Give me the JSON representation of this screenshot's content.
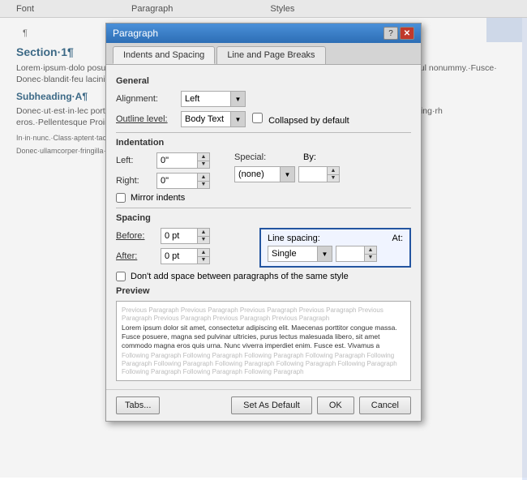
{
  "toolbar": {
    "items": [
      "Font",
      "Paragraph",
      "Styles"
    ]
  },
  "document": {
    "pilcrow": "¶",
    "section_title": "Section·1¶",
    "section_body": "Lorem·ipsum·dolo posuere,·magna·s quis·urna.·Nunc· tristique·senectu et·orci.·Aenean·n scelerisque·at,·vul nonummy.·Fusce· Donec·blandit·feu lacinia·nulla·nisl·e",
    "subheading": "Subheading·A¶",
    "sub_body": "Donec·ut·est·in·lec porta·tristique.·Pr senectus·et·netus· vulputate·vel,·auc lacinia·egestas·ac· ante·adipiscing·rh eros.·Pellentesque Proin·semper,·ant eget,·Sed·vel eget,·consequat·q",
    "footer_text": "In·in·nunc.·Class·aptent·taciti·sociosqu·ad·litora·torquent·per·conubia·nostra,·per·inceptos·hymenaeos.",
    "footer_text2": "Donec·ullamcorper·fringilla·eros.·Fusce·in·sapien·eu·purus·dapibus·commodo.·Cum·sociis·natoque"
  },
  "dialog": {
    "title": "Paragraph",
    "help_btn": "?",
    "close_btn": "✕",
    "tabs": [
      {
        "label": "Indents and Spacing",
        "active": true
      },
      {
        "label": "Line and Page Breaks",
        "active": false
      }
    ],
    "sections": {
      "general": {
        "label": "General",
        "alignment_label": "Alignment:",
        "alignment_value": "Left",
        "outline_label": "Outline level:",
        "outline_value": "Body Text",
        "collapsed_label": "Collapsed by default"
      },
      "indentation": {
        "label": "Indentation",
        "left_label": "Left:",
        "left_value": "0\"",
        "right_label": "Right:",
        "right_value": "0\"",
        "special_label": "Special:",
        "special_value": "(none)",
        "by_label": "By:",
        "mirror_label": "Mirror indents"
      },
      "spacing": {
        "label": "Spacing",
        "before_label": "Before:",
        "before_value": "0 pt",
        "after_label": "After:",
        "after_value": "0 pt",
        "dont_add_label": "Don't add space between paragraphs of the same style",
        "line_spacing_label": "Line spacing:",
        "at_label": "At:",
        "line_spacing_value": "Single"
      }
    },
    "preview": {
      "label": "Preview",
      "prev_para": "Previous Paragraph Previous Paragraph Previous Paragraph Previous Paragraph Previous Paragraph Previous Paragraph Previous Paragraph Previous Paragraph",
      "main_text": "Lorem ipsum dolor sit amet, consectetur adipiscing elit. Maecenas porttitor congue massa. Fusce posuere, magna sed pulvinar ultricies, purus lectus malesuada libero, sit amet commodo magna eros quis urna. Nunc viverra imperdiet enim. Fusce est. Vivamus a",
      "following_para": "Following Paragraph Following Paragraph Following Paragraph Following Paragraph Following Paragraph Following Paragraph Following Paragraph Following Paragraph Following Paragraph Following Paragraph Following Paragraph Following Paragraph"
    },
    "buttons": {
      "tabs": "Tabs...",
      "set_default": "Set As Default",
      "ok": "OK",
      "cancel": "Cancel"
    }
  }
}
